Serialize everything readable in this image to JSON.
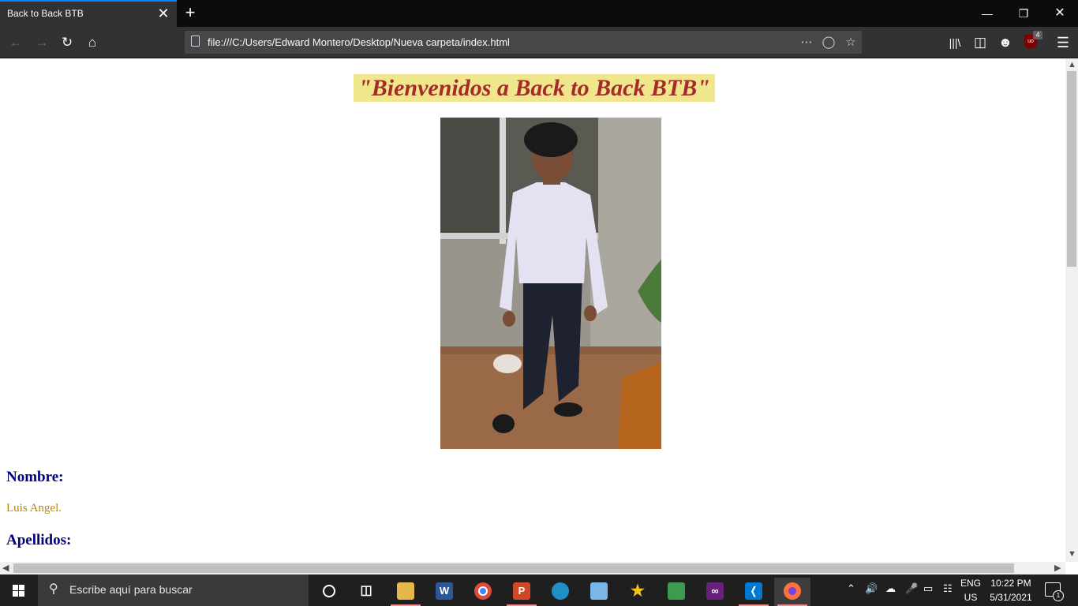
{
  "browser": {
    "tab_title": "Back to Back BTB",
    "tab_close": "✕",
    "new_tab": "+",
    "url": "file:///C:/Users/Edward Montero/Desktop/Nueva carpeta/index.html",
    "addon_badge": "4",
    "addon_label": "uo"
  },
  "page": {
    "heading": "\"Bienvenidos a Back to Back BTB\"",
    "nombre_label": "Nombre:",
    "nombre_value": "Luis Angel.",
    "apellidos_label": "Apellidos:"
  },
  "taskbar": {
    "search_placeholder": "Escribe aquí para buscar",
    "lang_top": "ENG",
    "lang_bottom": "US",
    "time": "10:22 PM",
    "date": "5/31/2021",
    "notifications_count": "1",
    "apps": [
      "task-view",
      "file-explorer",
      "word",
      "chrome",
      "powerpoint",
      "edge",
      "app-blue-box",
      "app-star",
      "app-green",
      "visual-studio",
      "vscode",
      "firefox"
    ]
  },
  "colors": {
    "heading_bg": "#f0e68c",
    "heading_text": "#a52a2a",
    "section_heading": "#000080",
    "value_text": "#b8860b",
    "tab_accent": "#0a84ff"
  }
}
